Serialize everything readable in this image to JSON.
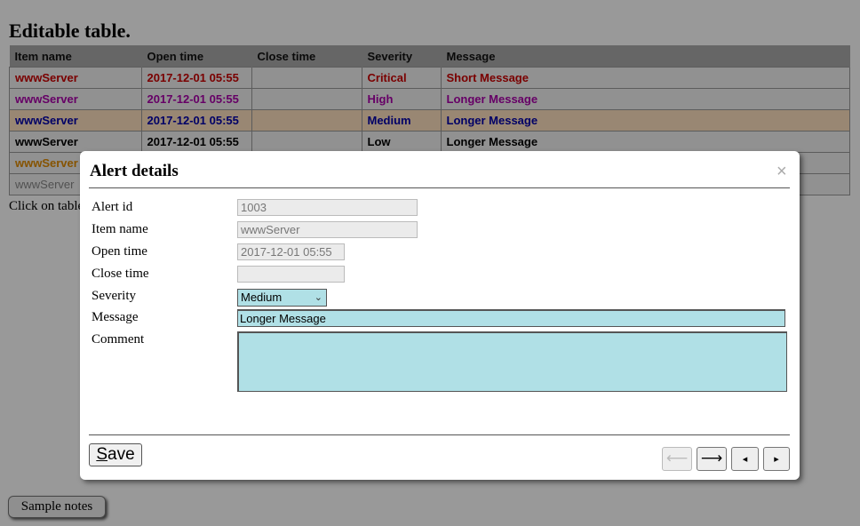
{
  "page": {
    "title": "Editable table.",
    "hint": "Click on table",
    "notes_button": "Sample notes"
  },
  "table": {
    "headers": [
      "Item name",
      "Open time",
      "Close time",
      "Severity",
      "Message"
    ],
    "rows": [
      {
        "item": "wwwServer",
        "open": "2017-12-01 05:55",
        "close": "",
        "severity": "Critical",
        "message": "Short Message",
        "color": "#cc0000"
      },
      {
        "item": "wwwServer",
        "open": "2017-12-01 05:55",
        "close": "",
        "severity": "High",
        "message": "Longer Message",
        "color": "#aa00aa"
      },
      {
        "item": "wwwServer",
        "open": "2017-12-01 05:55",
        "close": "",
        "severity": "Medium",
        "message": "Longer Message",
        "color": "#0000aa",
        "selected": true
      },
      {
        "item": "wwwServer",
        "open": "2017-12-01 05:55",
        "close": "",
        "severity": "Low",
        "message": "Longer Message",
        "color": "#000000"
      },
      {
        "item": "wwwServer",
        "open": "",
        "close": "",
        "severity": "",
        "message": "",
        "color": "#e08a00"
      },
      {
        "item": "wwwServer",
        "open": "",
        "close": "",
        "severity": "",
        "message": "",
        "color": "#888888",
        "bold": false
      }
    ]
  },
  "dialog": {
    "title": "Alert details",
    "close_glyph": "×",
    "labels": {
      "alert_id": "Alert id",
      "item_name": "Item name",
      "open_time": "Open time",
      "close_time": "Close time",
      "severity": "Severity",
      "message": "Message",
      "comment": "Comment"
    },
    "values": {
      "alert_id": "1003",
      "item_name": "wwwServer",
      "open_time": "2017-12-01 05:55",
      "close_time": "",
      "severity": "Medium",
      "message": "Longer Message",
      "comment": ""
    },
    "save_label_first": "S",
    "save_label_rest": "ave",
    "nav": {
      "prev_long": "⟵",
      "next_long": "⟶",
      "prev_small": "◂",
      "next_small": "▸"
    }
  },
  "colors": {
    "accent_field": "#b0e0e6",
    "selected_row": "#ffe1c0"
  }
}
